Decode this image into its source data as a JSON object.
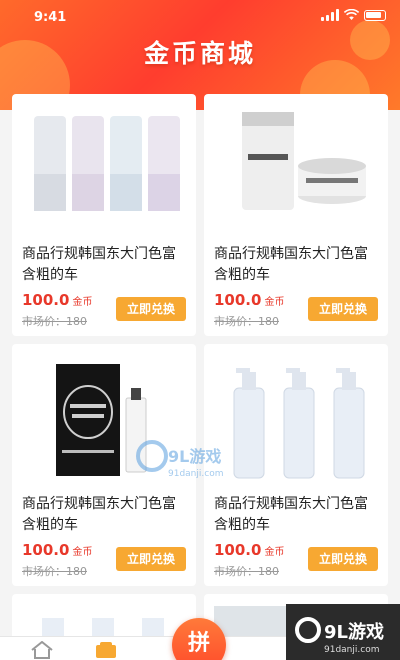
{
  "status_bar": {
    "time": "9:41"
  },
  "header": {
    "title": "金币商城"
  },
  "products": [
    {
      "name": "商品行规韩国东大门色富含粗的车",
      "price": "100.0",
      "unit": "金币",
      "market_price": "市场价：180",
      "button": "立即兑换",
      "image": "laneige-bottles"
    },
    {
      "name": "商品行规韩国东大门色富含粗的车",
      "price": "100.0",
      "unit": "金币",
      "market_price": "市场价：180",
      "button": "立即兑换",
      "image": "skincare-tube-jar"
    },
    {
      "name": "商品行规韩国东大门色富含粗的车",
      "price": "100.0",
      "unit": "金币",
      "market_price": "市场价：180",
      "button": "立即兑换",
      "image": "perfume-box"
    },
    {
      "name": "商品行规韩国东大门色富含粗的车",
      "price": "100.0",
      "unit": "金币",
      "market_price": "市场价：180",
      "button": "立即兑换",
      "image": "pump-bottles"
    }
  ],
  "tabbar": {
    "fab_label": "拼",
    "items": [
      {
        "icon": "home-icon"
      },
      {
        "icon": "shop-icon"
      }
    ]
  },
  "watermark": {
    "brand": "9L游戏",
    "url": "91danji.com"
  },
  "colors": {
    "header": "#ff4a2e",
    "price": "#e8382a",
    "button": "#f7a832"
  }
}
